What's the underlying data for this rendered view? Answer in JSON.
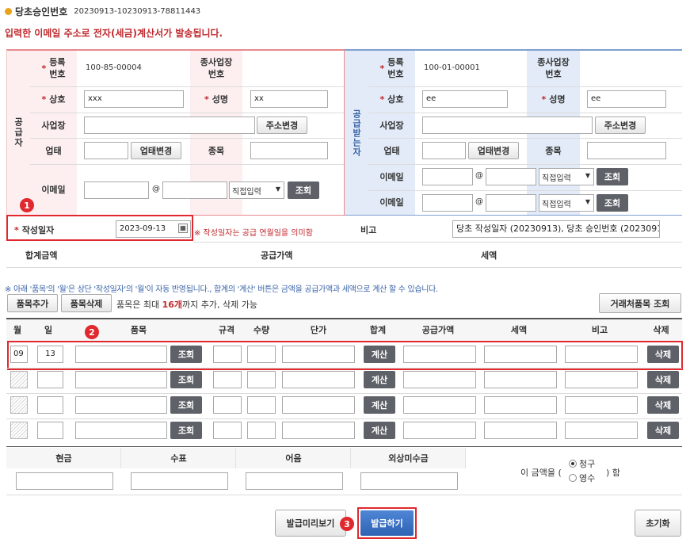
{
  "approval": {
    "label": "당초승인번호",
    "value": "20230913-10230913-78811443"
  },
  "notice": "입력한 이메일 주소로 전자(세금)계산서가 발송됩니다.",
  "supplier": {
    "side_label": "공급자",
    "reg_no_label": "등록\n번호",
    "reg_no": "100-85-00004",
    "branch_label": "종사업장\n번호",
    "name_label": "상호",
    "name": "xxx",
    "rep_label": "성명",
    "rep": "xx",
    "address_label": "사업장",
    "address_btn": "주소변경",
    "biz_type_label": "업태",
    "biz_type_btn": "업태변경",
    "biz_item_label": "종목",
    "email_label": "이메일",
    "at": "@",
    "email_select": "직접입력",
    "lookup_btn": "조회"
  },
  "receiver": {
    "side_label": "공급받는자",
    "reg_no_label": "등록\n번호",
    "reg_no": "100-01-00001",
    "branch_label": "종사업장\n번호",
    "name_label": "상호",
    "name": "ee",
    "rep_label": "성명",
    "rep": "ee",
    "address_label": "사업장",
    "address_btn": "주소변경",
    "biz_type_label": "업태",
    "biz_type_btn": "업태변경",
    "biz_item_label": "종목",
    "email_label": "이메일",
    "email2_label": "이메일",
    "at": "@",
    "email_select": "직접입력",
    "lookup_btn": "조회"
  },
  "date": {
    "label": "작성일자",
    "value": "2023-09-13",
    "note": "※ 작성일자는 공급 연월일을 의미함",
    "remark_label": "비고",
    "remark_value": "당초 작성일자 (20230913), 당초 승인번호 (2023091"
  },
  "totals": {
    "total_label": "합계금액",
    "supply_label": "공급가액",
    "tax_label": "세액"
  },
  "items_notice": "※ 아래 '품목'의 '월'은 상단 '작성일자'의 '월'이 자동 반영됩니다., 합계의 '계산' 버튼은 금액을 공급가액과 세액으로 계산 할 수 있습니다.",
  "item_controls": {
    "add_btn": "품목추가",
    "delete_btn": "품목삭제",
    "limit_prefix": "품목은 최대 ",
    "limit_count": "16개",
    "limit_suffix": "까지 추가, 삭제 가능",
    "client_items_btn": "거래처품목 조회"
  },
  "item_headers": [
    "월",
    "일",
    "품목",
    "규격",
    "수량",
    "단가",
    "합계",
    "공급가액",
    "세액",
    "비고",
    "삭제"
  ],
  "item_rows": [
    {
      "month": "09",
      "day": "13"
    },
    {
      "month": "",
      "day": ""
    },
    {
      "month": "",
      "day": ""
    },
    {
      "month": "",
      "day": ""
    }
  ],
  "item_buttons": {
    "lookup": "조회",
    "calc": "계산",
    "delete": "삭제"
  },
  "payment": {
    "headers": [
      "현금",
      "수표",
      "어음",
      "외상미수금"
    ],
    "amount_prefix": "이 금액을 (",
    "amount_suffix": ") 함",
    "opt_claim": "청구",
    "opt_receipt": "영수",
    "selected": "청구"
  },
  "badges": [
    "1",
    "2",
    "3"
  ],
  "actions": {
    "preview": "발급미리보기",
    "issue": "발급하기",
    "reset": "초기화"
  },
  "colors": {
    "accent_red": "#e0282e",
    "supplier_bg": "#fdeff0",
    "receiver_bg": "#e2ebf7",
    "dark_button": "#5e6168",
    "issue_button": "#3b72c4"
  }
}
